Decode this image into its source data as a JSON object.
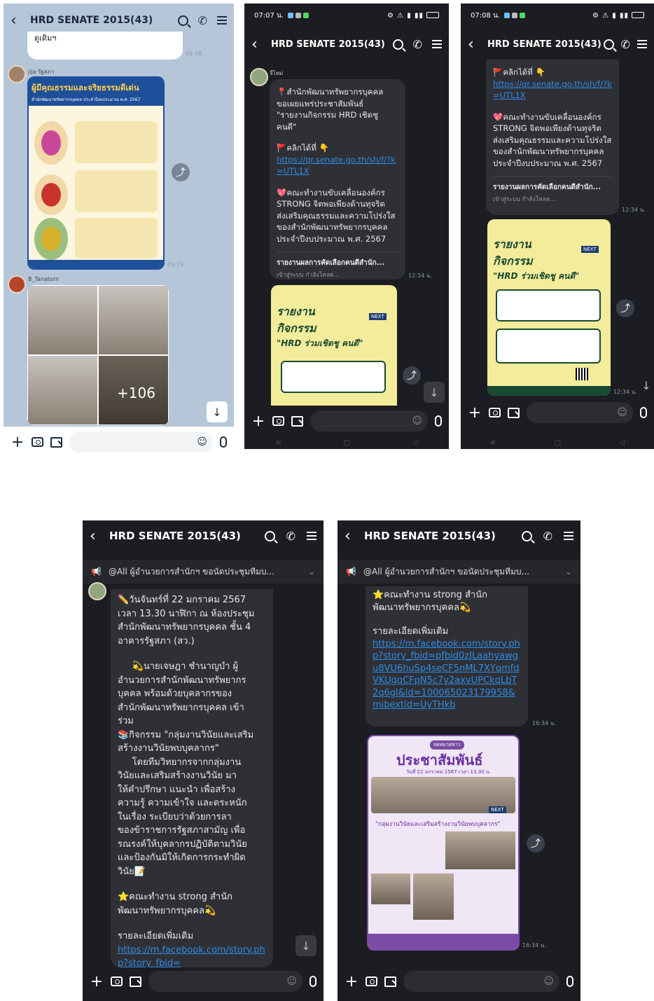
{
  "chat": {
    "group_name": "HRD SENATE 2015(43)",
    "announcement": "@All ผู้อำนวยการสำนักฯ ขอนัดประชุมทีมบ..."
  },
  "status": {
    "time_a": "07:07 น.",
    "time_b": "07:08 น."
  },
  "icons": {
    "back": "chevron-left-icon",
    "search": "search-icon",
    "call": "phone-icon",
    "menu": "menu-icon",
    "plus": "plus-icon",
    "camera": "camera-icon",
    "gallery": "image-icon",
    "emoji": "emoji-icon",
    "mic": "mic-icon",
    "share": "share-icon",
    "scroll": "arrow-down-icon",
    "announce": "megaphone-icon"
  },
  "panel1": {
    "top_bubble_text": "ดูเดิมฯ",
    "top_time": "09:38",
    "sender1": "jija รัฐสภา",
    "poster_title": "ผู้มีคุณธรรมและจริยธรรมดีเด่น",
    "poster_sub": "สำนักพัฒนาทรัพยากรบุคคล ประจำปีงบประมาณ พ.ศ. 2567",
    "poster_time": "09:39",
    "sender2": "B_Tanatorn",
    "photo_more": "+106"
  },
  "panel2": {
    "sender": "จีไหม่",
    "lines": [
      "📍สำนักพัฒนาทรัพยากรบุคคล",
      "ขอเผยแพร่ประชาสัมพันธ์",
      "\"รายงานกิจกรรม HRD เชิดชู คนดี\"",
      "",
      "🚩คลิกได้ที่ 👇"
    ],
    "link": "https://qr.senate.go.th/sh/f/?k=UTL1X",
    "lines2": [
      "💖คณะทำงานขับเคลื่อนองค์กร",
      "STRONG จิตพอเพียงต้านทุจริต",
      "ส่งเสริมคุณธรรมและความโปร่งใส",
      "ของสำนักพัฒนาทรัพยากรบุคคล",
      "ประจำปีงบประมาณ พ.ศ. 2567"
    ],
    "preview_title": "รายงานผลการคัดเลือกคนดีสำนัก...",
    "preview_sub": "เข้าสู่ระบบ กำลังโหลด...",
    "time": "12:34 น.",
    "poster_l1": "รายงาน",
    "poster_l2": "กิจกรรม",
    "poster_l3": "\"HRD ร่วมเชิดชู คนดี\"",
    "poster_badge": "NEXT"
  },
  "panel3": {
    "lines": [
      "🚩คลิกได้ที่ 👇"
    ],
    "link": "https://qr.senate.go.th/sh/f/?k=UTL1X",
    "lines2": [
      "💖คณะทำงานขับเคลื่อนองค์กร",
      "STRONG จิตพอเพียงต้านทุจริต",
      "ส่งเสริมคุณธรรมและความโปร่งใส",
      "ของสำนักพัฒนาทรัพยากรบุคคล",
      "ประจำปีงบประมาณ พ.ศ. 2567"
    ],
    "preview_title": "รายงานผลการคัดเลือกคนดีสำนัก...",
    "preview_sub": "เข้าสู่ระบบ กำลังโหลด...",
    "time": "12:34 น.",
    "poster_time": "12:34 น.",
    "poster_l1": "รายงาน",
    "poster_l2": "กิจกรรม",
    "poster_l3": "\"HRD ร่วมเชิดชู คนดี\"",
    "poster_badge": "NEXT"
  },
  "panel4": {
    "lines": [
      "✏️วันจันทร์ที่ 22 มกราคม 2567",
      "เวลา 13.30 นาฬิกา ณ ห้องประชุม",
      "สำนักพัฒนาทรัพยากรบุคคล ชั้น 4",
      "อาคารรัฐสภา (สว.)",
      "",
      "     💫นายเจษฎา ชำนาญบำ ผู้",
      "อำนวยการสำนักพัฒนาทรัพยากร",
      "บุคคล พร้อมด้วยบุคลากรของ",
      "สำนักพัฒนาทรัพยากรบุคคล เข้า",
      "ร่วม",
      "📚กิจกรรม \"กลุ่มงานวินัยและเสริม",
      "สร้างงานวินัยพบบุคลากร\"",
      "     โดยทีมวิทยากรจากกลุ่มงาน",
      "วินัยและเสริมสร้างงานวินัย มา",
      "ให้คำปรึกษา แนะนำ เพื่อสร้าง",
      "ความรู้ ความเข้าใจ และตระหนัก",
      "ในเรื่อง ระเบียบว่าด้วยการลา",
      "ของข้าราชการรัฐสภาสามัญ เพื่อ",
      "รณรงค์ให้บุคลากรปฏิบัติตามวินัย",
      "และป้องกันมิให้เกิดการกระทำผิด",
      "วินัย📝",
      "",
      "⭐คณะทำงาน strong สำนัก",
      "พัฒนาทรัพยากรบุคคล💫",
      "",
      "รายละเอียดเพิ่มเติม"
    ],
    "link": "https://m.facebook.com/story.php?story_fbid="
  },
  "panel5": {
    "lines": [
      "⭐คณะทำงาน strong สำนัก",
      "พัฒนาทรัพยากรบุคคล💫",
      "",
      "รายละเอียดเพิ่มเติม"
    ],
    "link": "https://m.facebook.com/story.php?story_fbid=pfbid0zJLaahyawgu8VU6huSp4seCF5nML7XYqmfdVKUgqCFpN5c7y2axvUPCkqLbT2q6gl&id=100065023179958&mibextid=UyTHkb",
    "time": "16:34 น.",
    "poster_tag": "จดหมายข่าว",
    "poster_title": "ประชาสัมพันธ์",
    "poster_date": "วันที่ 22 มกราคม 2567 เวลา 13.30 น.",
    "poster_caption": "\"กลุ่มงานวินัยและเสริมสร้างงานวินัยพบบุคลากร\"",
    "poster_badge": "NEXT",
    "poster_time": "16:34 น."
  }
}
